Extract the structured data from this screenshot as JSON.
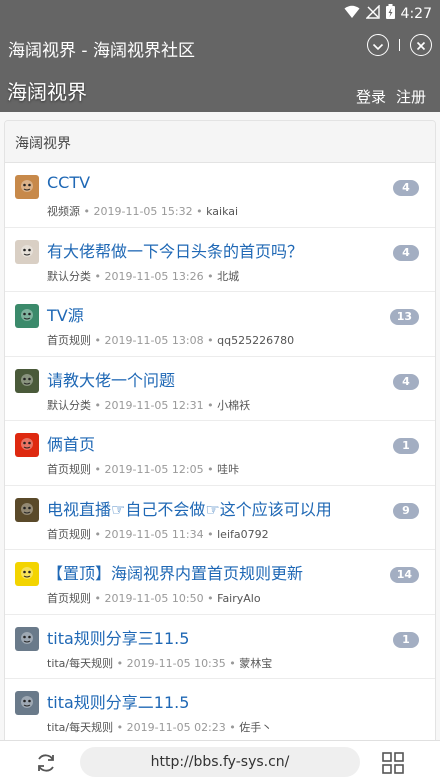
{
  "statusbar": {
    "time": "4:27"
  },
  "titlebar": {
    "title": "海阔视界 - 海阔视界社区"
  },
  "header": {
    "site_name": "海阔视界",
    "login": "登录",
    "register": "注册"
  },
  "section": {
    "title": "海阔视界"
  },
  "topics": [
    {
      "title": "CCTV",
      "category": "视频源",
      "time": "2019-11-05 15:32",
      "user": "kaikai",
      "replies": "4",
      "avatar": "sunglasses-avatar-icon",
      "avatar_color": "#c7894a"
    },
    {
      "title": "有大佬帮做一下今日头条的首页吗？",
      "category": "默认分类",
      "time": "2019-11-05 13:26",
      "user": "北城",
      "replies": "4",
      "avatar": "anime-avatar-icon",
      "avatar_color": "#d9cfc4"
    },
    {
      "title": "TV源",
      "category": "首页规则",
      "time": "2019-11-05 13:08",
      "user": "qq525226780",
      "replies": "13",
      "avatar": "cartoon-avatar-icon",
      "avatar_color": "#3b8a6b"
    },
    {
      "title": "请教大佬一个问题",
      "category": "默认分类",
      "time": "2019-11-05 12:31",
      "user": "小棉袄",
      "replies": "4",
      "avatar": "dark-face-avatar-icon",
      "avatar_color": "#4a5a3a"
    },
    {
      "title": "俩首页",
      "category": "首页规则",
      "time": "2019-11-05 12:05",
      "user": "哇咔",
      "replies": "1",
      "avatar": "flag-avatar-icon",
      "avatar_color": "#de2910"
    },
    {
      "title": "电视直播☞自己不会做☞这个应该可以用",
      "category": "首页规则",
      "time": "2019-11-05 11:34",
      "user": "leifa0792",
      "replies": "9",
      "avatar": "face-avatar-icon",
      "avatar_color": "#5a4a2a"
    },
    {
      "title": "【置顶】海阔视界内置首页规则更新",
      "category": "首页规则",
      "time": "2019-11-05 10:50",
      "user": "FairyAlo",
      "replies": "14",
      "avatar": "yellow-clock-avatar-icon",
      "avatar_color": "#f3d400"
    },
    {
      "title": "tita规则分享三11.5",
      "category": "tita/每天规则",
      "time": "2019-11-05 10:35",
      "user": "蒙林宝",
      "replies": "1",
      "avatar": "character-avatar-icon",
      "avatar_color": "#6a7a8a"
    },
    {
      "title": "tita规则分享二11.5",
      "category": "tita/每天规则",
      "time": "2019-11-05 02:23",
      "user": "佐手丶",
      "replies": "",
      "avatar": "character-avatar-icon",
      "avatar_color": "#6a7a8a"
    }
  ],
  "bottombar": {
    "url": "http://bbs.fy-sys.cn/"
  }
}
